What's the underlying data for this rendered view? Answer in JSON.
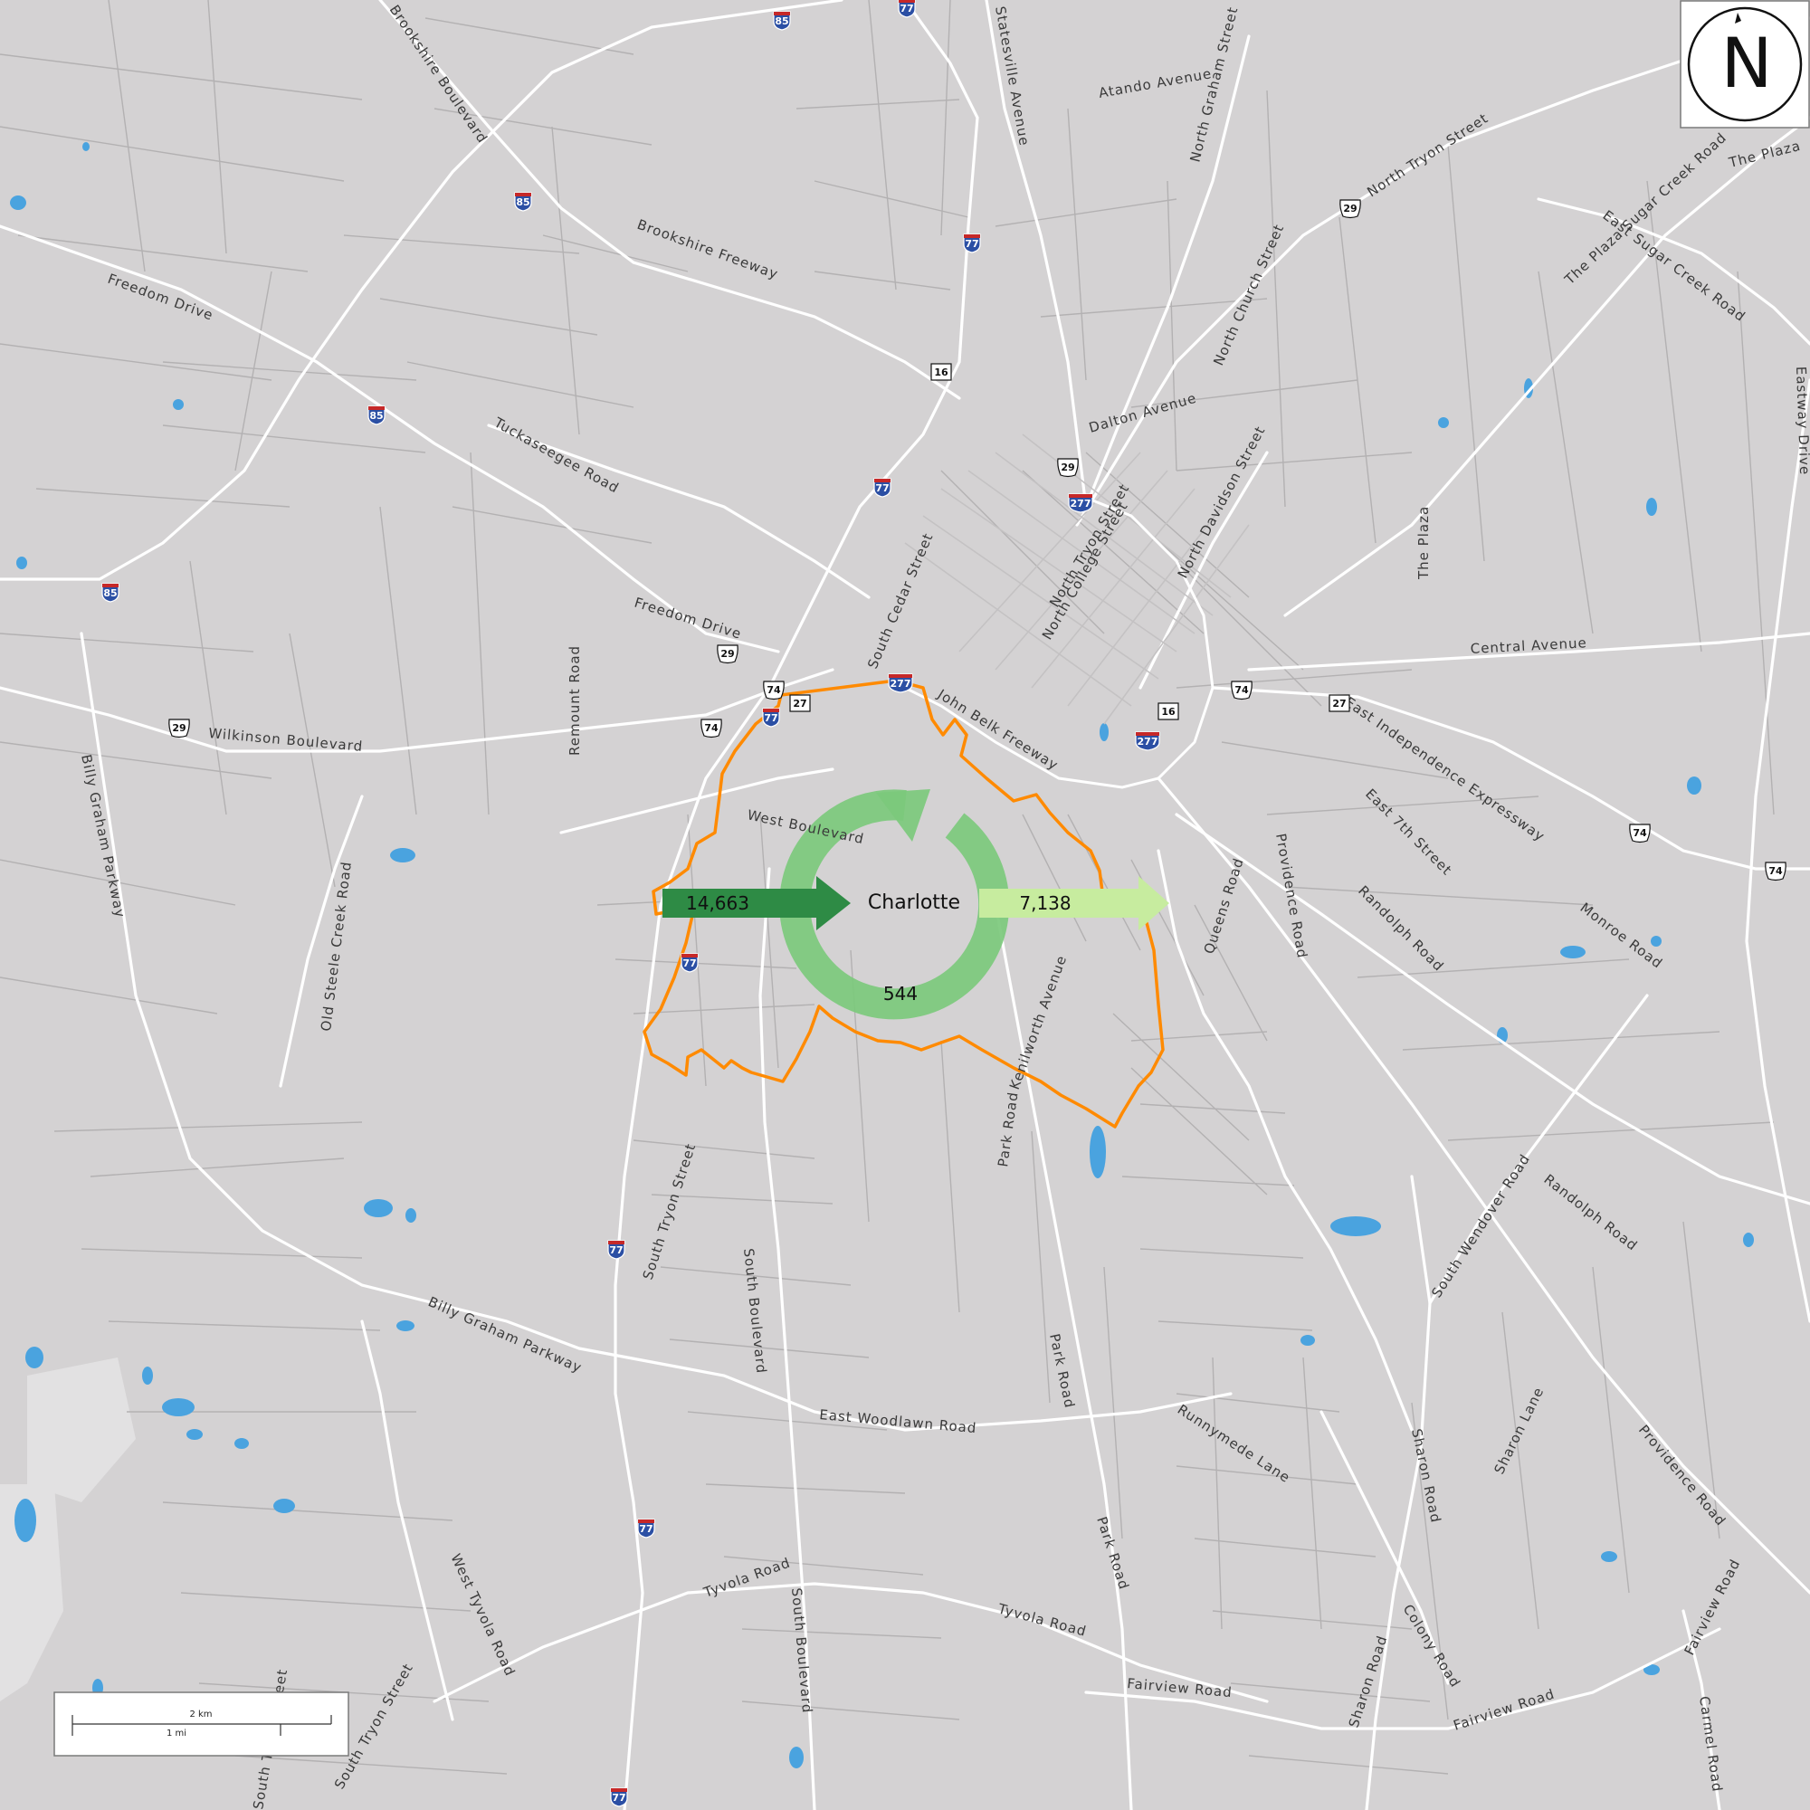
{
  "map": {
    "colors": {
      "land": "#d4d2d3",
      "minor_road": "#a9a7a8",
      "major_road": "#ffffff",
      "water": "#4aa3df",
      "boundary": "#ff8a00",
      "inflow_arrow": "#2e8b45",
      "outflow_arrow": "#c7ec9f",
      "internal_ring": "#7cc97c"
    },
    "city": {
      "label": "Charlotte"
    },
    "flows": {
      "inflow": "14,663",
      "outflow": "7,138",
      "internal": "544"
    },
    "north_arrow": {
      "label": "N"
    },
    "scale_bar": {
      "km_label": "2 km",
      "mi_label": "1 mi"
    },
    "road_labels": [
      "Brookshire Boulevard",
      "Statesville Avenue",
      "Atando Avenue",
      "North Graham Street",
      "North Tryon Street",
      "The Plaza",
      "East Sugar Creek Road",
      "The Plaza Sugar Creek Road",
      "Freedom Drive",
      "Brookshire Freeway",
      "North Church Street",
      "Eastway Drive",
      "Dalton Avenue",
      "Tuckaseegee Road",
      "North Davidson Street",
      "North Tryon Street",
      "North College Street",
      "The Plaza",
      "South Cedar Street",
      "Freedom Drive",
      "Central Avenue",
      "John Belk Freeway",
      "East Independence Expressway",
      "Wilkinson Boulevard",
      "Remount Road",
      "West Boulevard",
      "East 7th Street",
      "Billy Graham Parkway",
      "Queens Road",
      "Providence Road",
      "Randolph Road",
      "Monroe Road",
      "Old Steele Creek Road",
      "Kenilworth Avenue",
      "Park Road",
      "South Tryon Street",
      "South Boulevard",
      "Randolph Road",
      "South Wendover Road",
      "Billy Graham Parkway",
      "Park Road",
      "East Woodlawn Road",
      "Runnymede Lane",
      "Sharon Road",
      "Sharon Lane",
      "Providence Road",
      "West Tyvola Road",
      "Tyvola Road",
      "South Boulevard",
      "Tyvola Road",
      "Park Road",
      "Colony Road",
      "Sharon Road",
      "Fairview Road",
      "Fairview Road",
      "Fairview Road",
      "Carmel Road",
      "South Tryon Street",
      "South Tryon Street"
    ],
    "shields": [
      {
        "type": "interstate",
        "label": "85"
      },
      {
        "type": "interstate",
        "label": "77"
      },
      {
        "type": "interstate",
        "label": "85"
      },
      {
        "type": "interstate",
        "label": "77"
      },
      {
        "type": "interstate",
        "label": "85"
      },
      {
        "type": "interstate",
        "label": "77"
      },
      {
        "type": "interstate",
        "label": "277"
      },
      {
        "type": "interstate",
        "label": "85"
      },
      {
        "type": "interstate",
        "label": "277"
      },
      {
        "type": "interstate",
        "label": "77"
      },
      {
        "type": "interstate",
        "label": "277"
      },
      {
        "type": "interstate",
        "label": "77"
      },
      {
        "type": "interstate",
        "label": "77"
      },
      {
        "type": "interstate",
        "label": "77"
      },
      {
        "type": "interstate",
        "label": "77"
      },
      {
        "type": "us",
        "label": "29"
      },
      {
        "type": "us",
        "label": "29"
      },
      {
        "type": "us",
        "label": "29"
      },
      {
        "type": "us",
        "label": "29"
      },
      {
        "type": "us",
        "label": "74"
      },
      {
        "type": "us",
        "label": "74"
      },
      {
        "type": "us",
        "label": "74"
      },
      {
        "type": "us",
        "label": "74"
      },
      {
        "type": "us",
        "label": "74"
      },
      {
        "type": "state",
        "label": "16"
      },
      {
        "type": "state",
        "label": "16"
      },
      {
        "type": "state",
        "label": "27"
      },
      {
        "type": "state",
        "label": "27"
      }
    ]
  }
}
